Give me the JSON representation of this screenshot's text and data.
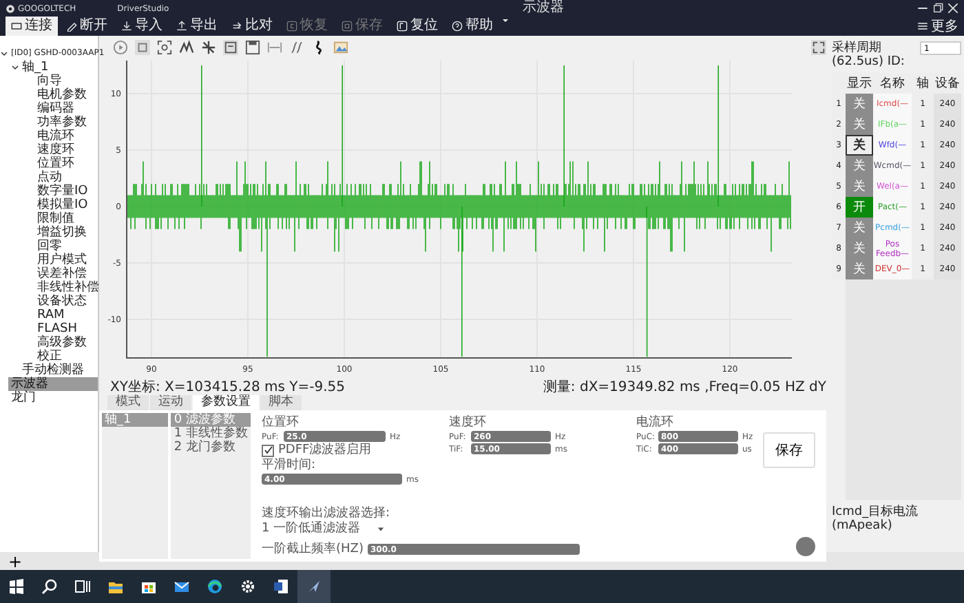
{
  "window": {
    "logo": "GOOGOLTECH",
    "app": "DriverStudio",
    "title": "示波器",
    "more": "更多"
  },
  "menu": [
    {
      "label": "连接",
      "selected": true,
      "disabled": false
    },
    {
      "label": "断开",
      "selected": false,
      "disabled": false
    },
    {
      "label": "导入",
      "selected": false,
      "disabled": false
    },
    {
      "label": "导出",
      "selected": false,
      "disabled": false
    },
    {
      "label": "比对",
      "selected": false,
      "disabled": false
    },
    {
      "label": "恢复",
      "selected": false,
      "disabled": true
    },
    {
      "label": "保存",
      "selected": false,
      "disabled": true
    },
    {
      "label": "复位",
      "selected": false,
      "disabled": false
    },
    {
      "label": "帮助",
      "selected": false,
      "disabled": false
    }
  ],
  "tree": [
    {
      "label": "[ID0] GSHD-0003AAP1",
      "expanded": true,
      "selected": false,
      "children": [
        {
          "label": "轴_1",
          "expanded": true,
          "selected": false,
          "children": [
            {
              "label": "向导",
              "selected": false
            },
            {
              "label": "电机参数",
              "selected": false
            },
            {
              "label": "编码器",
              "selected": false
            },
            {
              "label": "功率参数",
              "selected": false
            },
            {
              "label": "电流环",
              "selected": false
            },
            {
              "label": "速度环",
              "selected": false
            },
            {
              "label": "位置环",
              "selected": false
            },
            {
              "label": "点动",
              "selected": false
            },
            {
              "label": "数字量IO",
              "selected": false
            },
            {
              "label": "模拟量IO",
              "selected": false
            },
            {
              "label": "限制值",
              "selected": false
            },
            {
              "label": "增益切换",
              "selected": false
            },
            {
              "label": "回零",
              "selected": false
            },
            {
              "label": "用户模式",
              "selected": false
            },
            {
              "label": "误差补偿",
              "selected": false
            },
            {
              "label": "非线性补偿",
              "selected": false
            },
            {
              "label": "设备状态",
              "selected": false
            },
            {
              "label": "RAM",
              "selected": false
            },
            {
              "label": "FLASH",
              "selected": false
            },
            {
              "label": "高级参数",
              "selected": false
            },
            {
              "label": "校正",
              "selected": false
            }
          ]
        },
        {
          "label": "手动检测器",
          "selected": false
        }
      ]
    },
    {
      "label": "示波器",
      "selected": true
    },
    {
      "label": "龙门",
      "selected": false
    }
  ],
  "chart": {
    "x_ticks": [
      "90",
      "95",
      "100",
      "105",
      "110",
      "115",
      "120"
    ],
    "y_ticks": [
      "10",
      "5",
      "0",
      "-5",
      "-10"
    ],
    "cursor_readout": "XY坐标: X=103415.28 ms  Y=-9.55",
    "measure_readout": "测量: dX=19349.82 ms ,Freq=0.05 HZ dY"
  },
  "sampling": {
    "label": "采样周期(62.5us) ID:",
    "value": "1"
  },
  "signals": {
    "columns": [
      "显示",
      "名称",
      "轴",
      "设备"
    ],
    "rows": [
      {
        "index": "1",
        "display": "关",
        "on": false,
        "selected": false,
        "name": "Icmd(—",
        "color": "#e04848",
        "axis": "1",
        "device": "240"
      },
      {
        "index": "2",
        "display": "关",
        "on": false,
        "selected": false,
        "name": "IFb(a—",
        "color": "#5fd35f",
        "axis": "1",
        "device": "240"
      },
      {
        "index": "3",
        "display": "关",
        "on": false,
        "selected": true,
        "name": "Wfd(—",
        "color": "#4b3ee0",
        "axis": "1",
        "device": "240"
      },
      {
        "index": "4",
        "display": "关",
        "on": false,
        "selected": false,
        "name": "Wcmd(—",
        "color": "#555566",
        "axis": "1",
        "device": "240"
      },
      {
        "index": "5",
        "display": "关",
        "on": false,
        "selected": false,
        "name": "Wel(a—",
        "color": "#d050d0",
        "axis": "1",
        "device": "240"
      },
      {
        "index": "6",
        "display": "开",
        "on": true,
        "selected": false,
        "name": "Pact(—",
        "color": "#2aa02a",
        "axis": "1",
        "device": "240"
      },
      {
        "index": "7",
        "display": "关",
        "on": false,
        "selected": false,
        "name": "Pcmd(—",
        "color": "#3aa0e0",
        "axis": "1",
        "device": "240"
      },
      {
        "index": "8",
        "display": "关",
        "on": false,
        "selected": false,
        "name": "Pos Feedb—",
        "color": "#b030c0",
        "axis": "1",
        "device": "240"
      },
      {
        "index": "9",
        "display": "关",
        "on": false,
        "selected": false,
        "name": "DEV_0—",
        "color": "#d03030",
        "axis": "1",
        "device": "240"
      }
    ]
  },
  "signal_caption": "Icmd_目标电流(mApeak)",
  "bottom": {
    "tabs": [
      {
        "label": "模式",
        "selected": false
      },
      {
        "label": "运动",
        "selected": false
      },
      {
        "label": "参数设置",
        "selected": true
      },
      {
        "label": "脚本",
        "selected": false
      }
    ],
    "axes": [
      {
        "label": "轴_1",
        "selected": true
      }
    ],
    "groups": [
      {
        "label": "0 滤波参数",
        "selected": true
      },
      {
        "label": "1 非线性参数",
        "selected": false
      },
      {
        "label": "2 龙门参数",
        "selected": false
      }
    ],
    "position_loop": {
      "title": "位置环",
      "fields": [
        {
          "label": "PuF:",
          "value": "25.0",
          "unit": "Hz"
        }
      ]
    },
    "pdff": {
      "label": "PDFF滤波器启用",
      "checked": true
    },
    "smoothing": {
      "label": "平滑时间:",
      "value": "4.00",
      "unit": "ms"
    },
    "speed_loop": {
      "title": "速度环",
      "fields": [
        {
          "label": "PuF:",
          "value": "260",
          "unit": "Hz"
        },
        {
          "label": "TiF:",
          "value": "15.00",
          "unit": "ms"
        }
      ]
    },
    "current_loop": {
      "title": "电流环",
      "fields": [
        {
          "label": "PuC:",
          "value": "800",
          "unit": "Hz"
        },
        {
          "label": "TiC:",
          "value": "400",
          "unit": "us"
        }
      ]
    },
    "save": "保存",
    "filter_select": {
      "label": "速度环输出滤波器选择:",
      "value": "1 一阶低通滤波器"
    },
    "cutoff": {
      "label": "一阶截止频率(HZ)",
      "value": "300.0"
    }
  },
  "add_button": "+"
}
